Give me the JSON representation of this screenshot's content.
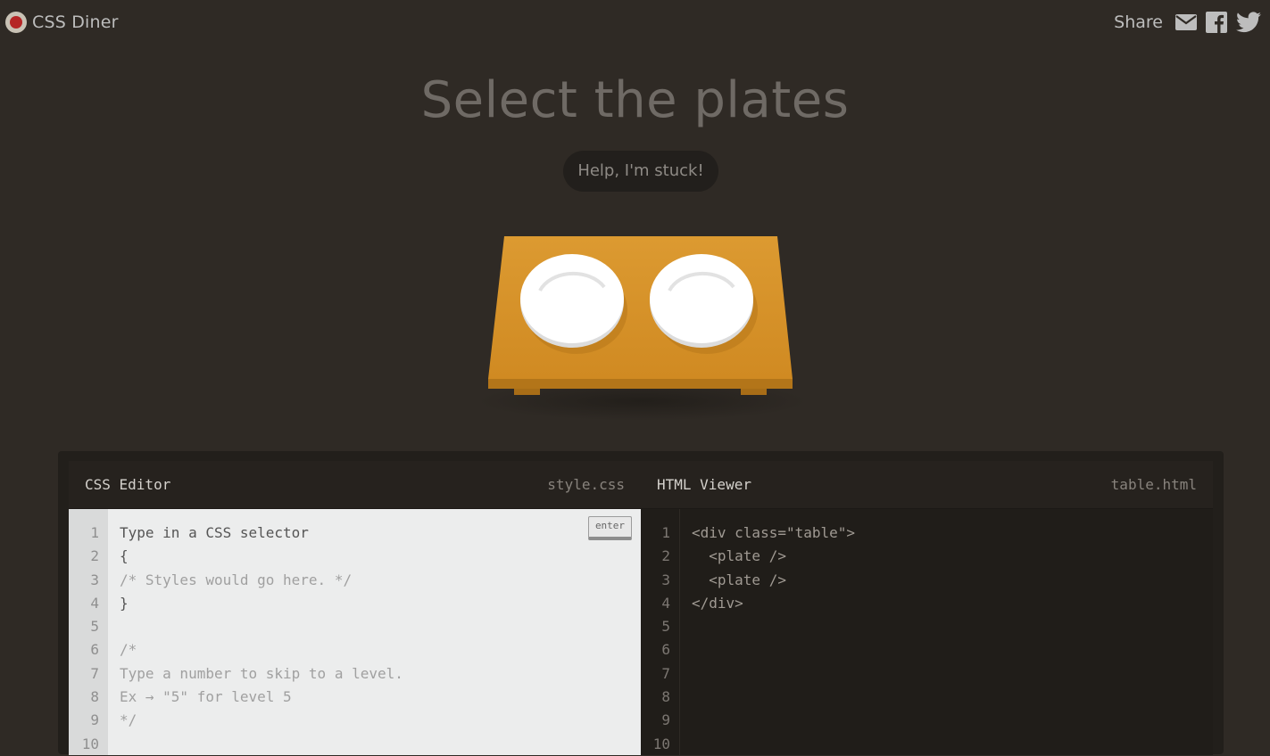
{
  "header": {
    "logo_text": "CSS Diner",
    "share_label": "Share",
    "icons": [
      "mail-icon",
      "facebook-icon",
      "twitter-icon"
    ]
  },
  "level": {
    "title": "Select the plates",
    "help_label": "Help, I'm stuck!"
  },
  "css_editor": {
    "title": "CSS Editor",
    "file": "style.css",
    "enter_label": "enter",
    "line_numbers": [
      "1",
      "2",
      "3",
      "4",
      "5",
      "6",
      "7",
      "8",
      "9",
      "10"
    ],
    "lines": [
      {
        "text": "Type in a CSS selector",
        "kind": "main"
      },
      {
        "text": "{",
        "kind": "main"
      },
      {
        "text": "/* Styles would go here. */",
        "kind": "cm"
      },
      {
        "text": "}",
        "kind": "main"
      },
      {
        "text": "",
        "kind": "main"
      },
      {
        "text": "/*",
        "kind": "cm"
      },
      {
        "text": "Type a number to skip to a level.",
        "kind": "cm"
      },
      {
        "text": "Ex → \"5\" for level 5",
        "kind": "cm"
      },
      {
        "text": "*/",
        "kind": "cm"
      },
      {
        "text": "",
        "kind": "main"
      }
    ]
  },
  "html_viewer": {
    "title": "HTML Viewer",
    "file": "table.html",
    "line_numbers": [
      "1",
      "2",
      "3",
      "4",
      "5",
      "6",
      "7",
      "8",
      "9",
      "10"
    ],
    "lines": [
      "<div class=\"table\">",
      "  <plate />",
      "  <plate />",
      "</div>",
      "",
      "",
      "",
      "",
      "",
      ""
    ]
  },
  "colors": {
    "background": "#2f2a25",
    "table_top": "#db9730",
    "table_edge": "#b87a1c",
    "plate": "#ffffff",
    "logo_red": "#b52525"
  }
}
